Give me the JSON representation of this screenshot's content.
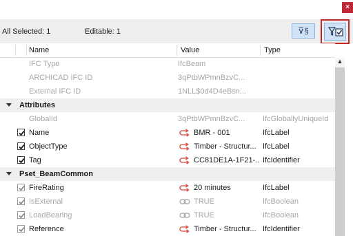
{
  "window": {
    "close_glyph": "×"
  },
  "toolbar": {
    "all_selected": "All Selected: 1",
    "editable": "Editable: 1",
    "filter_button_label": "⊽§",
    "filter_checked_icon": "filter-checkbox-icon"
  },
  "columns": {
    "name": "Name",
    "value": "Value",
    "type": "Type"
  },
  "rows": [
    {
      "kind": "prop",
      "name": "IFC Type",
      "value": "IfcBeam",
      "type": "",
      "checkbox": "none",
      "value_icon": "none",
      "muted": true
    },
    {
      "kind": "prop",
      "name": "ARCHICAD IFC ID",
      "value": "3qPtbWPmnBzvC...",
      "type": "",
      "checkbox": "none",
      "value_icon": "none",
      "muted": true
    },
    {
      "kind": "prop",
      "name": "External IFC ID",
      "value": "1NLL$0d4D4eBsn...",
      "type": "",
      "checkbox": "none",
      "value_icon": "none",
      "muted": true
    },
    {
      "kind": "section",
      "name": "Attributes"
    },
    {
      "kind": "prop",
      "name": "GlobalId",
      "value": "3qPtbWPmnBzvC...",
      "type": "IfcGloballyUniqueId",
      "checkbox": "none",
      "value_icon": "none",
      "muted": true
    },
    {
      "kind": "prop",
      "name": "Name",
      "value": "BMR - 001",
      "type": "IfcLabel",
      "checkbox": "checked",
      "value_icon": "mapped",
      "muted": false
    },
    {
      "kind": "prop",
      "name": "ObjectType",
      "value": "Timber - Structur...",
      "type": "IfcLabel",
      "checkbox": "checked",
      "value_icon": "mapped",
      "muted": false
    },
    {
      "kind": "prop",
      "name": "Tag",
      "value": "CC81DE1A-1F21-...",
      "type": "IfcIdentifier",
      "checkbox": "checked",
      "value_icon": "mapped",
      "muted": false
    },
    {
      "kind": "section",
      "name": "Pset_BeamCommon"
    },
    {
      "kind": "prop",
      "name": "FireRating",
      "value": "20 minutes",
      "type": "IfcLabel",
      "checkbox": "checked-dim",
      "value_icon": "mapped",
      "muted": false
    },
    {
      "kind": "prop",
      "name": "IsExternal",
      "value": "TRUE",
      "type": "IfcBoolean",
      "checkbox": "checked-dim",
      "value_icon": "link",
      "muted": true
    },
    {
      "kind": "prop",
      "name": "LoadBearing",
      "value": "TRUE",
      "type": "IfcBoolean",
      "checkbox": "checked-dim",
      "value_icon": "link",
      "muted": true
    },
    {
      "kind": "prop",
      "name": "Reference",
      "value": "Timber - Structur...",
      "type": "IfcIdentifier",
      "checkbox": "checked-dim",
      "value_icon": "mapped",
      "muted": false
    }
  ],
  "colors": {
    "accent_red": "#c22a2a",
    "mapped_icon": "#d8473a",
    "selected_button": "#cfe2f6"
  }
}
